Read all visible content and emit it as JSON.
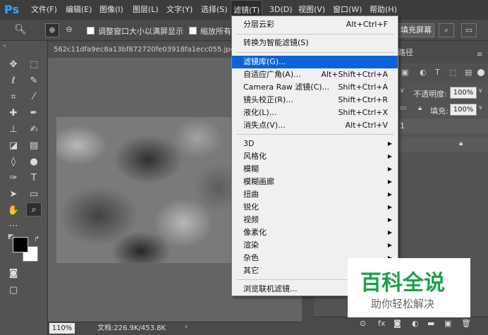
{
  "app": {
    "logo": "Ps"
  },
  "menubar": {
    "items": [
      {
        "label": "文件(F)"
      },
      {
        "label": "编辑(E)"
      },
      {
        "label": "图像(I)"
      },
      {
        "label": "图层(L)"
      },
      {
        "label": "文字(Y)"
      },
      {
        "label": "选择(S)"
      },
      {
        "label": "滤镜(T)"
      },
      {
        "label": "3D(D)"
      },
      {
        "label": "视图(V)"
      },
      {
        "label": "窗口(W)"
      },
      {
        "label": "帮助(H)"
      }
    ]
  },
  "options": {
    "resize_windows_label": "调整窗口大小以满屏显示",
    "zoom_all_label": "缩放所有",
    "fill_screen_label": "填充屏幕"
  },
  "document": {
    "tab_title": "562c11dfa9ec8a13bf872720fe03918fa1ecc055.jpg @",
    "zoom": "110%",
    "doc_info": "文档:226.9K/453.8K"
  },
  "panel": {
    "paths_tab": "路径",
    "opacity_label": "不透明度:",
    "opacity_value": "100%",
    "fill_label": "填充:",
    "fill_value": "100%",
    "layer_number": "1"
  },
  "filter_menu": {
    "items": [
      {
        "label": "分层云彩",
        "shortcut": "Alt+Ctrl+F"
      },
      {
        "label": "转换为智能滤镜(S)",
        "shortcut": ""
      },
      {
        "label": "滤镜库(G)...",
        "shortcut": ""
      },
      {
        "label": "自适应广角(A)...",
        "shortcut": "Alt+Shift+Ctrl+A"
      },
      {
        "label": "Camera Raw 滤镜(C)...",
        "shortcut": "Shift+Ctrl+A"
      },
      {
        "label": "镜头校正(R)...",
        "shortcut": "Shift+Ctrl+R"
      },
      {
        "label": "液化(L)...",
        "shortcut": "Shift+Ctrl+X"
      },
      {
        "label": "消失点(V)...",
        "shortcut": "Alt+Ctrl+V"
      },
      {
        "label": "3D",
        "shortcut": ""
      },
      {
        "label": "风格化",
        "shortcut": ""
      },
      {
        "label": "模糊",
        "shortcut": ""
      },
      {
        "label": "模糊画廊",
        "shortcut": ""
      },
      {
        "label": "扭曲",
        "shortcut": ""
      },
      {
        "label": "锐化",
        "shortcut": ""
      },
      {
        "label": "视频",
        "shortcut": ""
      },
      {
        "label": "像素化",
        "shortcut": ""
      },
      {
        "label": "渲染",
        "shortcut": ""
      },
      {
        "label": "杂色",
        "shortcut": ""
      },
      {
        "label": "其它",
        "shortcut": ""
      },
      {
        "label": "浏览联机滤镜...",
        "shortcut": ""
      }
    ]
  },
  "watermark": {
    "title": "百科全说",
    "subtitle": "助你轻松解决"
  }
}
